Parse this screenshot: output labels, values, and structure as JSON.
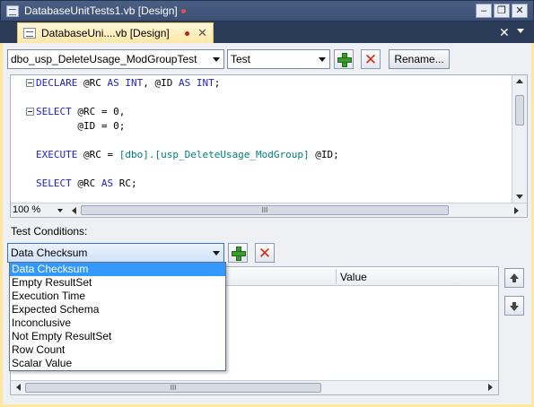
{
  "window": {
    "title": "DatabaseUnitTests1.vb [Design]",
    "buttons": {
      "minimize": "–",
      "restore": "❐",
      "close": "✕"
    }
  },
  "tab": {
    "label": "DatabaseUni....vb [Design]",
    "close": "✕",
    "strip_close": "✕"
  },
  "toolbar": {
    "test_selector": "dbo_usp_DeleteUsage_ModGroupTest",
    "script_type": "Test",
    "rename_label": "Rename..."
  },
  "editor": {
    "lines": [
      [
        {
          "t": "DECLARE ",
          "k": "kw"
        },
        {
          "t": "@RC ",
          "k": ""
        },
        {
          "t": "AS INT",
          "k": "kw"
        },
        {
          "t": ", @ID ",
          "k": ""
        },
        {
          "t": "AS INT",
          "k": "kw"
        },
        {
          "t": ";",
          "k": ""
        }
      ],
      [
        {
          "t": "SELECT ",
          "k": "kw"
        },
        {
          "t": "@RC = 0,",
          "k": ""
        }
      ],
      [
        {
          "t": "       @ID = 0;",
          "k": ""
        }
      ],
      [
        {
          "t": "EXECUTE ",
          "k": "kw"
        },
        {
          "t": "@RC = ",
          "k": ""
        },
        {
          "t": "[dbo].[usp_DeleteUsage_ModGroup]",
          "k": "ident"
        },
        {
          "t": " @ID;",
          "k": ""
        }
      ],
      [
        {
          "t": "SELECT ",
          "k": "kw"
        },
        {
          "t": "@RC ",
          "k": ""
        },
        {
          "t": "AS ",
          "k": "kw"
        },
        {
          "t": "RC;",
          "k": ""
        }
      ]
    ],
    "zoom": "100 %",
    "scroll_grip": "III"
  },
  "conditions": {
    "label": "Test Conditions:",
    "selected": "Data Checksum",
    "options": [
      "Data Checksum",
      "Empty ResultSet",
      "Execution Time",
      "Expected Schema",
      "Inconclusive",
      "Not Empty ResultSet",
      "Row Count",
      "Scalar Value"
    ],
    "grid_header_value": "Value",
    "scroll_grip": "III"
  },
  "colors": {
    "selection": "#3399ff",
    "keyword": "#1f1fd1",
    "identifier": "#008080",
    "tab_active": "#ffe8a6"
  }
}
